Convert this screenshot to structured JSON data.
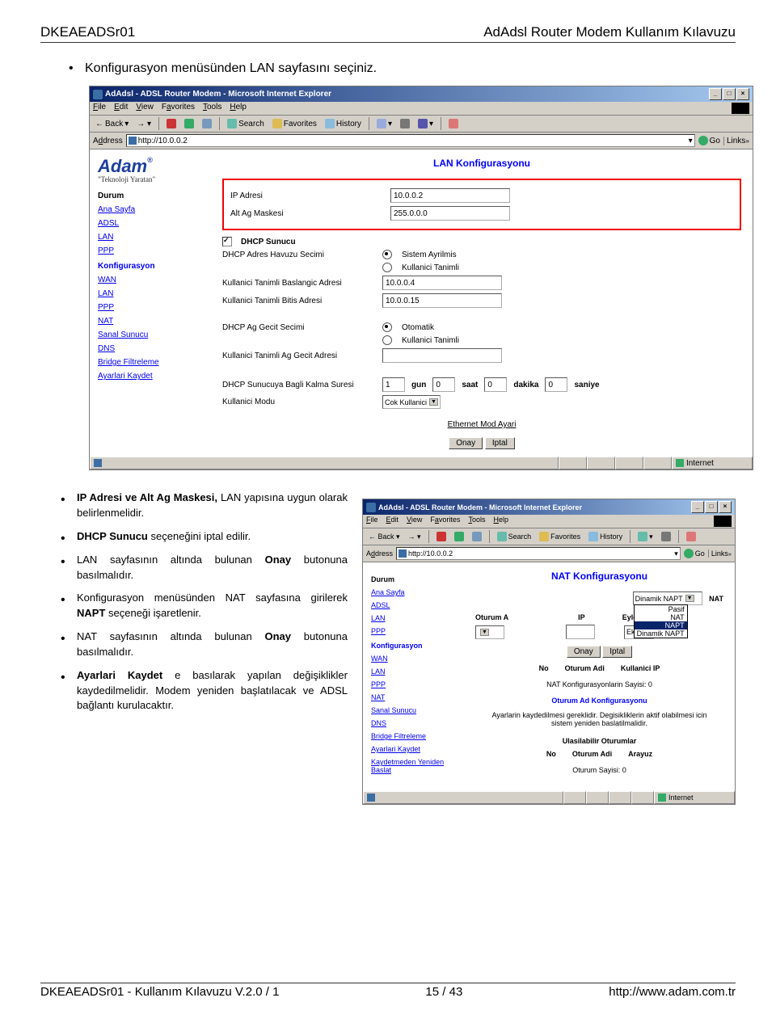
{
  "header": {
    "left": "DKEAEADSr01",
    "right": "AdAdsl Router Modem Kullanım Kılavuzu"
  },
  "footer": {
    "left": "DKEAEADSr01 - Kullanım Kılavuzu V.2.0 / 1",
    "center": "15 / 43",
    "right": "http://www.adam.com.tr"
  },
  "intro_bullet": "Konfigurasyon menüsünden LAN sayfasını seçiniz.",
  "browser1": {
    "title": "AdAdsl - ADSL Router Modem - Microsoft Internet Explorer",
    "menu": [
      "File",
      "Edit",
      "View",
      "Favorites",
      "Tools",
      "Help"
    ],
    "toolbar": {
      "back": "Back",
      "search": "Search",
      "favorites": "Favorites",
      "history": "History"
    },
    "address_label": "Address",
    "address": "http://10.0.0.2",
    "go": "Go",
    "links": "Links",
    "sidebar": {
      "logo": "Adam",
      "logo_r": "®",
      "tagline": "\"Teknoloji Yaratan\"",
      "section1": "Durum",
      "links1": [
        "Ana Sayfa",
        "ADSL",
        "LAN",
        "PPP"
      ],
      "section2": "Konfigurasyon",
      "links2": [
        "WAN",
        "LAN",
        "PPP",
        "NAT",
        "Sanal Sunucu",
        "DNS",
        "Bridge Filtreleme",
        "Ayarlari Kaydet"
      ]
    },
    "form": {
      "title": "LAN Konfigurasyonu",
      "ip_label": "IP Adresi",
      "ip_val": "10.0.0.2",
      "mask_label": "Alt Ag Maskesi",
      "mask_val": "255.0.0.0",
      "dhcp_srv": "DHCP Sunucu",
      "pool_label": "DHCP Adres Havuzu Secimi",
      "pool_opt1": "Sistem Ayrilmis",
      "pool_opt2": "Kullanici Tanimli",
      "start_label": "Kullanici Tanimli Baslangic Adresi",
      "start_val": "10.0.0.4",
      "end_label": "Kullanici Tanimli Bitis Adresi",
      "end_val": "10.0.0.15",
      "gw_label": "DHCP Ag Gecit Secimi",
      "gw_opt1": "Otomatik",
      "gw_opt2": "Kullanici Tanimli",
      "gw_addr_label": "Kullanici Tanimli Ag Gecit Adresi",
      "lease_label": "DHCP Sunucuya Bagli Kalma Suresi",
      "lease_v1": "1",
      "lease_u1": "gun",
      "lease_v2": "0",
      "lease_u2": "saat",
      "lease_v3": "0",
      "lease_u3": "dakika",
      "lease_v4": "0",
      "lease_u4": "saniye",
      "mode_label": "Kullanici Modu",
      "mode_val": "Cok Kullanici",
      "eth_label": "Ethernet Mod Ayari",
      "ok": "Onay",
      "cancel": "Iptal"
    },
    "status": "Internet"
  },
  "bullets2": [
    "<b>IP Adresi ve Alt Ag Maskesi,</b> LAN yapısına uygun olarak belirlenmelidir.",
    "<b>DHCP Sunucu</b> seçeneğini iptal edilir.",
    "LAN sayfasının altında bulunan <b>Onay</b> butonuna basılmalıdır.",
    "Konfigurasyon menüsünden NAT sayfasına girilerek <b>NAPT</b> seçeneği işaretlenir.",
    "NAT sayfasının altında bulunan <b>Onay</b> butonuna basılmalıdır.",
    "<b>Ayarlari Kaydet</b> e basılarak yapılan değişiklikler kaydedilmelidir. Modem yeniden başlatılacak ve ADSL bağlantı kurulacaktır."
  ],
  "browser2": {
    "title": "AdAdsl - ADSL Router Modem - Microsoft Internet Explorer",
    "address": "http://10.0.0.2",
    "sidebar": {
      "section1": "Durum",
      "links1": [
        "Ana Sayfa",
        "ADSL",
        "LAN",
        "PPP"
      ],
      "section2": "Konfigurasyon",
      "links2": [
        "WAN",
        "LAN",
        "PPP",
        "NAT",
        "Sanal Sunucu",
        "DNS",
        "Bridge Filtreleme",
        "Ayarlari Kaydet",
        "Kaydetmeden Yeniden Baslat"
      ]
    },
    "main": {
      "title": "NAT Konfigurasyonu",
      "nat_select": "Dinamik NAPT",
      "nat_label": "NAT",
      "nat_opts": [
        "Pasif",
        "NAT",
        "NAPT",
        "Dinamik NAPT"
      ],
      "oturum": "Oturum Adi",
      "ip": "IP",
      "eylem": "Eylem",
      "eylem_val": "Ekle",
      "ok": "Onay",
      "cancel": "Iptal",
      "th_no": "No",
      "th_oa": "Oturum Adi",
      "th_kip": "Kullanici IP",
      "nat_count": "NAT Konfigurasyonlarin Sayisi: 0",
      "sub2": "Oturum Ad Konfigurasyonu",
      "note": "Ayarlarin kaydedilmesi gereklidir. Degisikliklerin aktif olabilmesi icin sistem yeniden baslatilmalidir.",
      "sub3": "Ulasilabilir Oturumlar",
      "th_ar": "Arayuz",
      "sess_count": "Oturum Sayisi: 0"
    },
    "status": "Internet"
  }
}
